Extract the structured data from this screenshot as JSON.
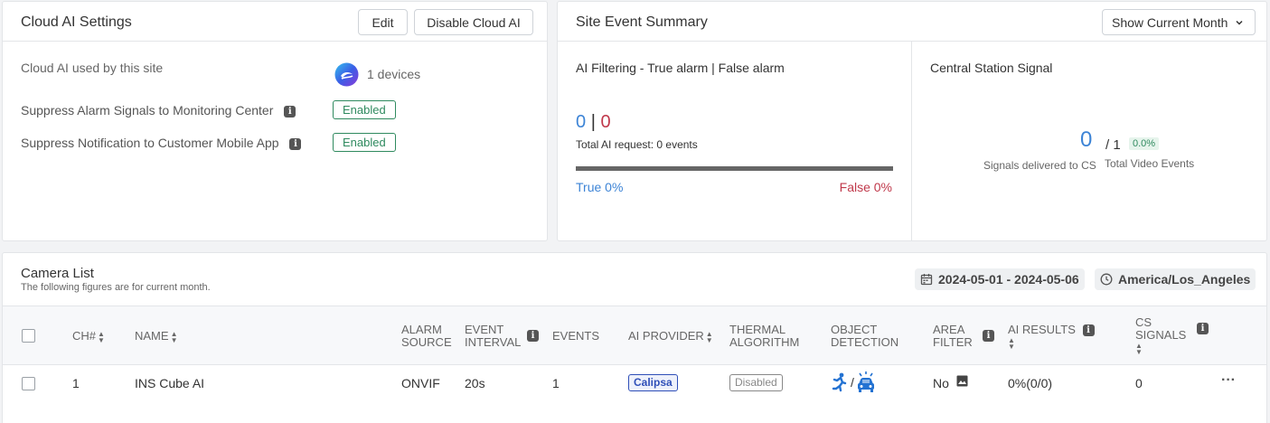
{
  "cloud_ai": {
    "title": "Cloud AI Settings",
    "edit_label": "Edit",
    "disable_label": "Disable Cloud AI",
    "used_label": "Cloud AI used by this site",
    "devices": "1 devices",
    "suppress_alarm_label": "Suppress Alarm Signals to Monitoring Center",
    "suppress_alarm_status": "Enabled",
    "suppress_notif_label": "Suppress Notification to Customer Mobile App",
    "suppress_notif_status": "Enabled"
  },
  "summary": {
    "title": "Site Event Summary",
    "period_select": "Show Current Month",
    "ai_filter_title": "AI Filtering - True alarm | False alarm",
    "true_count": "0",
    "sep": "|",
    "false_count": "0",
    "total_ai_request": "Total AI request: 0 events",
    "true_pct": "True 0%",
    "false_pct": "False 0%",
    "true_fraction": 0,
    "cs_title": "Central Station Signal",
    "cs_delivered": "0",
    "cs_total": "/ 1",
    "cs_pct": "0.0%",
    "cs_delivered_label": "Signals delivered to CS",
    "cs_total_label": "Total Video Events"
  },
  "camera_list": {
    "title": "Camera List",
    "subtitle": "The following figures are for current month.",
    "date_range": "2024-05-01 - 2024-05-06",
    "timezone": "America/Los_Angeles",
    "headers": {
      "ch": "CH#",
      "name": "NAME",
      "alarm_source_1": "ALARM",
      "alarm_source_2": "SOURCE",
      "event_interval_1": "EVENT",
      "event_interval_2": "INTERVAL",
      "events": "EVENTS",
      "ai_provider": "AI PROVIDER",
      "thermal_1": "THERMAL",
      "thermal_2": "ALGORITHM",
      "object_1": "OBJECT",
      "object_2": "DETECTION",
      "area_1": "AREA",
      "area_2": "FILTER",
      "ai_results": "AI RESULTS",
      "cs_1": "CS",
      "cs_2": "SIGNALS"
    },
    "rows": [
      {
        "ch": "1",
        "name": "INS Cube AI",
        "alarm_source": "ONVIF",
        "event_interval": "20s",
        "events": "1",
        "ai_provider": "Calipsa",
        "thermal": "Disabled",
        "object_sep": "/",
        "area_filter": "No",
        "ai_results": "0%(0/0)",
        "cs_signals": "0",
        "more": "···"
      }
    ]
  },
  "colors": {
    "true_blue": "#3d84d6",
    "false_red": "#c0394b",
    "enabled_green": "#2f8a5f",
    "calipsa_blue": "#2f4fb8",
    "icon_blue": "#2372d2"
  },
  "icons": [
    "ai-logo-icon",
    "info-icon",
    "chevron-down-icon",
    "calendar-icon",
    "clock-icon",
    "person-running-icon",
    "car-alarm-icon",
    "image-icon",
    "sort-icon",
    "more-icon"
  ]
}
